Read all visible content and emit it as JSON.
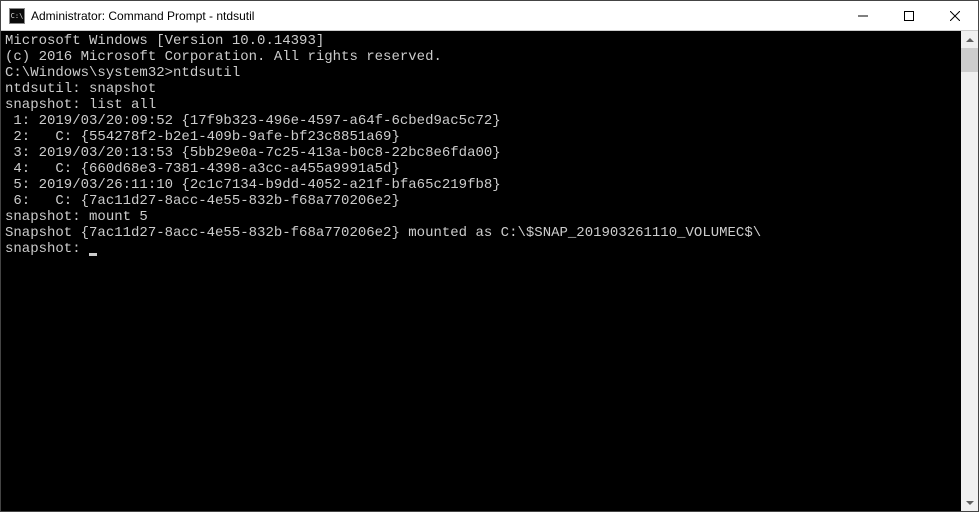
{
  "titlebar": {
    "icon_label": "C:\\",
    "title": "Administrator: Command Prompt - ntdsutil"
  },
  "terminal": {
    "lines": [
      "Microsoft Windows [Version 10.0.14393]",
      "(c) 2016 Microsoft Corporation. All rights reserved.",
      "",
      "C:\\Windows\\system32>ntdsutil",
      "ntdsutil: snapshot",
      "snapshot: list all",
      " 1: 2019/03/20:09:52 {17f9b323-496e-4597-a64f-6cbed9ac5c72}",
      " 2:   C: {554278f2-b2e1-409b-9afe-bf23c8851a69}",
      "",
      " 3: 2019/03/20:13:53 {5bb29e0a-7c25-413a-b0c8-22bc8e6fda00}",
      " 4:   C: {660d68e3-7381-4398-a3cc-a455a9991a5d}",
      "",
      " 5: 2019/03/26:11:10 {2c1c7134-b9dd-4052-a21f-bfa65c219fb8}",
      " 6:   C: {7ac11d27-8acc-4e55-832b-f68a770206e2}",
      "",
      "snapshot: mount 5",
      "Snapshot {7ac11d27-8acc-4e55-832b-f68a770206e2} mounted as C:\\$SNAP_201903261110_VOLUMEC$\\",
      "snapshot: "
    ]
  }
}
